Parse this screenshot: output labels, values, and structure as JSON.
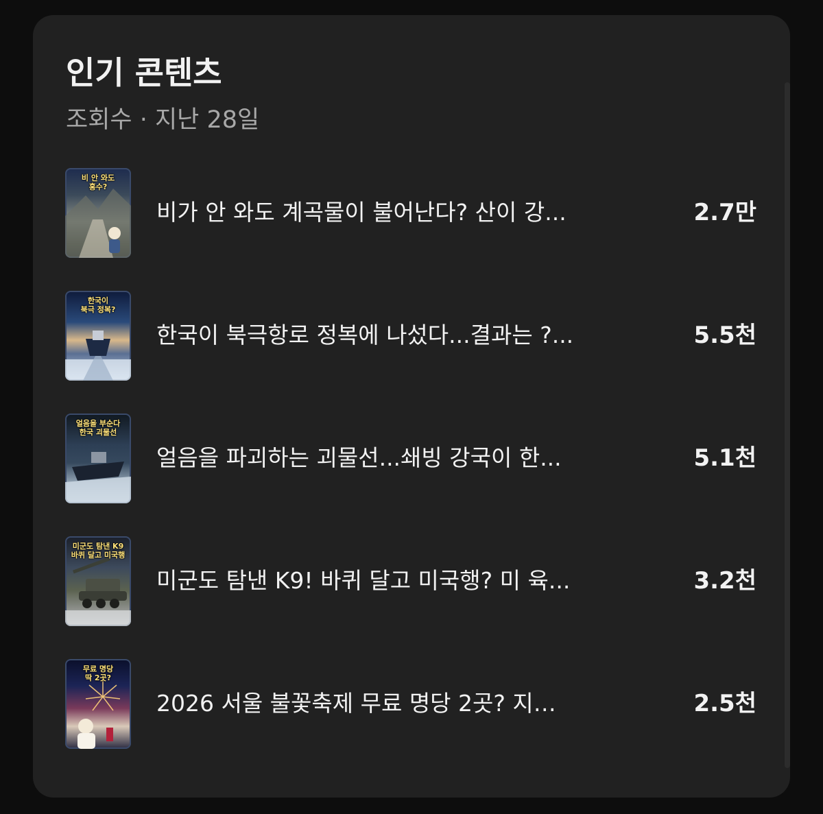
{
  "card": {
    "title": "인기 콘텐츠",
    "subtitle": "조회수 · 지난 28일"
  },
  "items": [
    {
      "thumbnail_text": "비 안 와도\n홍수?",
      "title": "비가 안 와도 계곡물이 불어난다? 산이 강...",
      "views": "2.7만"
    },
    {
      "thumbnail_text": "한국이\n북극 정복?",
      "title": "한국이 북극항로 정복에 나섰다...결과는 ?...",
      "views": "5.5천"
    },
    {
      "thumbnail_text": "얼음을 부순다\n한국 괴물선",
      "title": "얼음을 파괴하는 괴물선...쇄빙 강국이 한...",
      "views": "5.1천"
    },
    {
      "thumbnail_text": "미군도 탐낸 K9\n바퀴 달고 미국행",
      "title": "미군도 탐낸 K9! 바퀴 달고 미국행? 미 육...",
      "views": "3.2천"
    },
    {
      "thumbnail_text": "무료 명당\n딱 2곳?",
      "title": "2026 서울 불꽃축제 무료 명당 2곳? 지…",
      "views": "2.5천"
    }
  ]
}
